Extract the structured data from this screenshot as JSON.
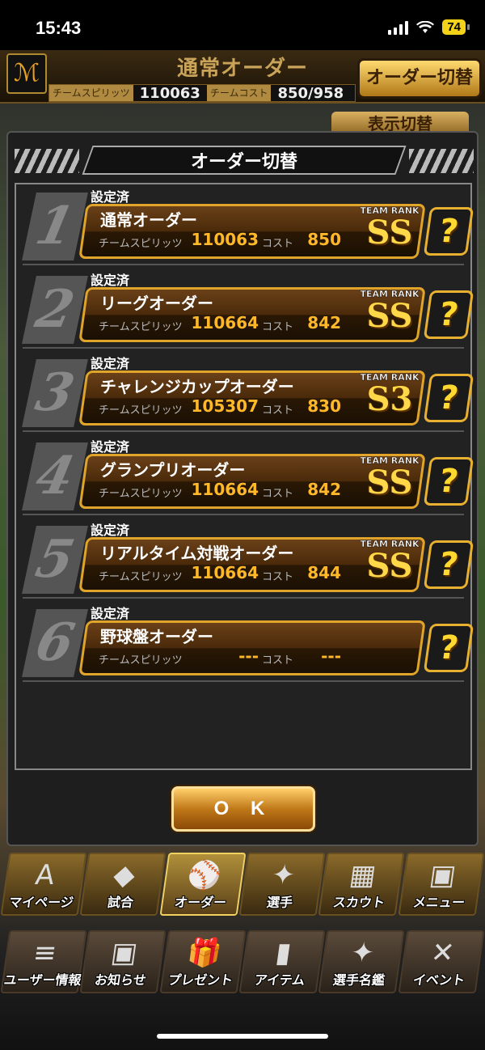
{
  "status": {
    "time": "15:43",
    "battery": "74"
  },
  "header": {
    "title": "通常オーダー",
    "spirits_label": "チームスピリッツ",
    "spirits_value": "110063",
    "cost_label": "チームコスト",
    "cost_value": "850/958",
    "switch_label": "オーダー切替",
    "display_switch_label": "表示切替"
  },
  "modal": {
    "title": "オーダー切替",
    "ok_label": "O K",
    "orders": [
      {
        "num": "1",
        "status": "設定済",
        "name": "通常オーダー",
        "spirits_label": "チームスピリッツ",
        "spirits": "110063",
        "cost_label": "コスト",
        "cost": "850",
        "rank_label": "TEAM RANK",
        "rank": "SS",
        "help": "?"
      },
      {
        "num": "2",
        "status": "設定済",
        "name": "リーグオーダー",
        "spirits_label": "チームスピリッツ",
        "spirits": "110664",
        "cost_label": "コスト",
        "cost": "842",
        "rank_label": "TEAM RANK",
        "rank": "SS",
        "help": "?"
      },
      {
        "num": "3",
        "status": "設定済",
        "name": "チャレンジカップオーダー",
        "spirits_label": "チームスピリッツ",
        "spirits": "105307",
        "cost_label": "コスト",
        "cost": "830",
        "rank_label": "TEAM RANK",
        "rank": "S3",
        "help": "?"
      },
      {
        "num": "4",
        "status": "設定済",
        "name": "グランプリオーダー",
        "spirits_label": "チームスピリッツ",
        "spirits": "110664",
        "cost_label": "コスト",
        "cost": "842",
        "rank_label": "TEAM RANK",
        "rank": "SS",
        "help": "?"
      },
      {
        "num": "5",
        "status": "設定済",
        "name": "リアルタイム対戦オーダー",
        "spirits_label": "チームスピリッツ",
        "spirits": "110664",
        "cost_label": "コスト",
        "cost": "844",
        "rank_label": "TEAM RANK",
        "rank": "SS",
        "help": "?"
      },
      {
        "num": "6",
        "status": "設定済",
        "name": "野球盤オーダー",
        "spirits_label": "チームスピリッツ",
        "spirits": "---",
        "cost_label": "コスト",
        "cost": "---",
        "rank_label": "",
        "rank": "",
        "help": "?"
      }
    ]
  },
  "nav_top": [
    {
      "label": "マイページ",
      "icon": "A"
    },
    {
      "label": "試合",
      "icon": "◆"
    },
    {
      "label": "オーダー",
      "icon": "⚾"
    },
    {
      "label": "選手",
      "icon": "✦"
    },
    {
      "label": "スカウト",
      "icon": "▦"
    },
    {
      "label": "メニュー",
      "icon": "▣"
    }
  ],
  "nav_bottom": [
    {
      "label": "ユーザー情報",
      "icon": "≡"
    },
    {
      "label": "お知らせ",
      "icon": "▣"
    },
    {
      "label": "プレゼント",
      "icon": "🎁"
    },
    {
      "label": "アイテム",
      "icon": "▮"
    },
    {
      "label": "選手名鑑",
      "icon": "✦"
    },
    {
      "label": "イベント",
      "icon": "✕"
    }
  ]
}
